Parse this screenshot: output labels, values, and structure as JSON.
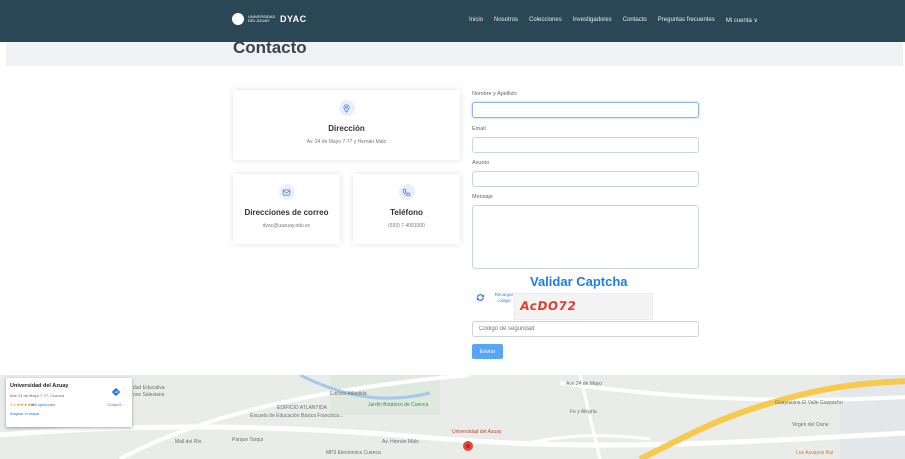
{
  "nav": {
    "brand_uni": "UNIVERSIDAD DEL AZUAY",
    "brand_name": "DYAC",
    "items": [
      "Inicio",
      "Nosotros",
      "Colecciones",
      "Investigadores",
      "Contacto",
      "Preguntas frecuentes",
      "Mi cuenta ∨"
    ]
  },
  "page_title": "Contacto",
  "address_card": {
    "title": "Dirección",
    "text": "Av. 24 de Mayo 7-77 y Hernán Malo"
  },
  "email_card": {
    "title": "Direcciones de correo",
    "text": "dyac@uazuay.edu.ec"
  },
  "phone_card": {
    "title": "Teléfono",
    "text": "(593) 7 4091000"
  },
  "form": {
    "name_label": "Nombre y Apellido",
    "name_value": "",
    "email_label": "Email",
    "email_value": "",
    "subject_label": "Asunto",
    "subject_value": "",
    "message_label": "Mensaje",
    "message_value": "",
    "captcha_title": "Validar Captcha",
    "reload_label": "Recargar código",
    "captcha_code": "AcDO72",
    "security_placeholder": "Código de seguridad",
    "submit_label": "Enviar"
  },
  "map": {
    "place_title": "Universidad del Azuay",
    "place_address": "Ave 24 de Mayo 7-77, Cuenca",
    "rating_value": "4.6",
    "rating_stars": "★★★★★",
    "reviews": "166 opiniones",
    "enlarge": "Ampliar el mapa",
    "directions": "Cómo ll...",
    "labels": [
      "dad Educativa",
      "nos Salesiano",
      "Edificio Atlantida",
      "EDIFICIO ATLANTIDA",
      "Jardín Botánico de Cuenca",
      "Escuela de Educación Básica Francisca...",
      "Mall del Río",
      "Parque Tarqui",
      "Universidad del Azuay",
      "Av. Hernán Malo",
      "Fe y Alegría",
      "Guayusana El Valle Gaspacho",
      "Virgen del Cisne",
      "MP3 Electronics Cuenca",
      "Los Azuayos Bar",
      "Ave 24 de Mayo"
    ]
  }
}
